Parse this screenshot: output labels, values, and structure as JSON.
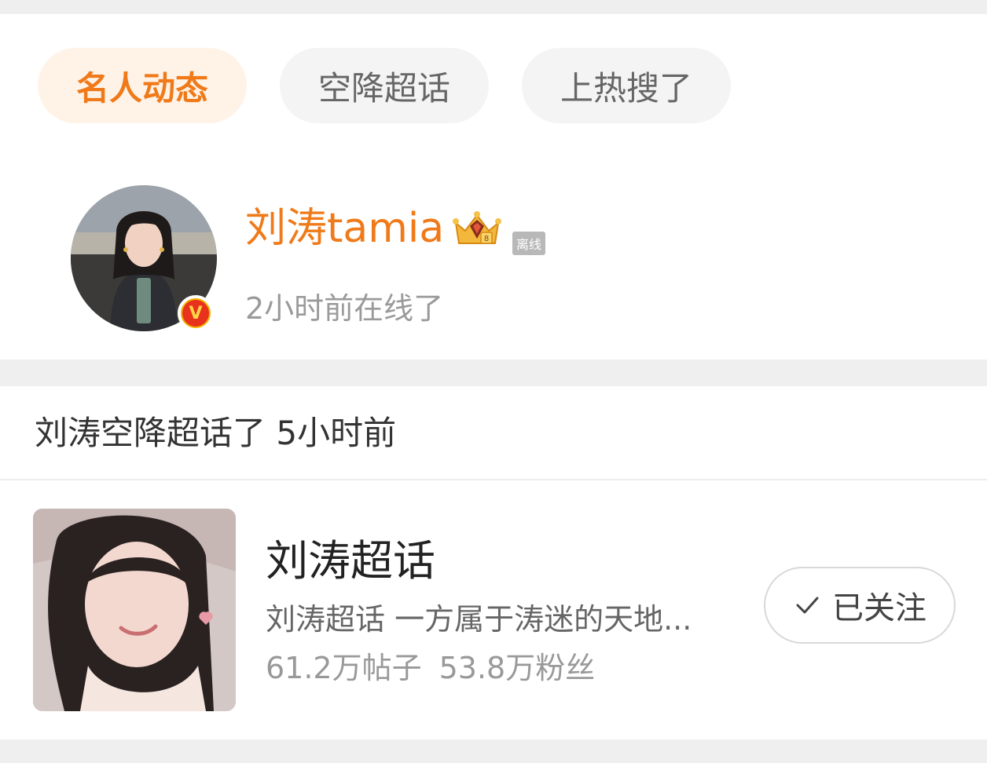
{
  "tabs": [
    {
      "label": "名人动态",
      "active": true
    },
    {
      "label": "空降超话",
      "active": false
    },
    {
      "label": "上热搜了",
      "active": false
    }
  ],
  "profile": {
    "name": "刘涛tamia",
    "status_badge": "离线",
    "online_text": "2小时前在线了",
    "verified_mark": "V"
  },
  "activity": {
    "line": "刘涛空降超话了 5小时前"
  },
  "topic": {
    "title": "刘涛超话",
    "description": "刘涛超话 一方属于涛迷的天地...",
    "posts": "61.2万帖子",
    "fans": "53.8万粉丝",
    "follow_label": "已关注"
  },
  "colors": {
    "accent": "#f07a19",
    "tab_active_bg": "#fff3e8",
    "tab_bg": "#f4f4f4"
  },
  "icons": {
    "crown": "crown-level-badge-icon",
    "verified": "verified-v-icon",
    "check": "check-icon"
  }
}
